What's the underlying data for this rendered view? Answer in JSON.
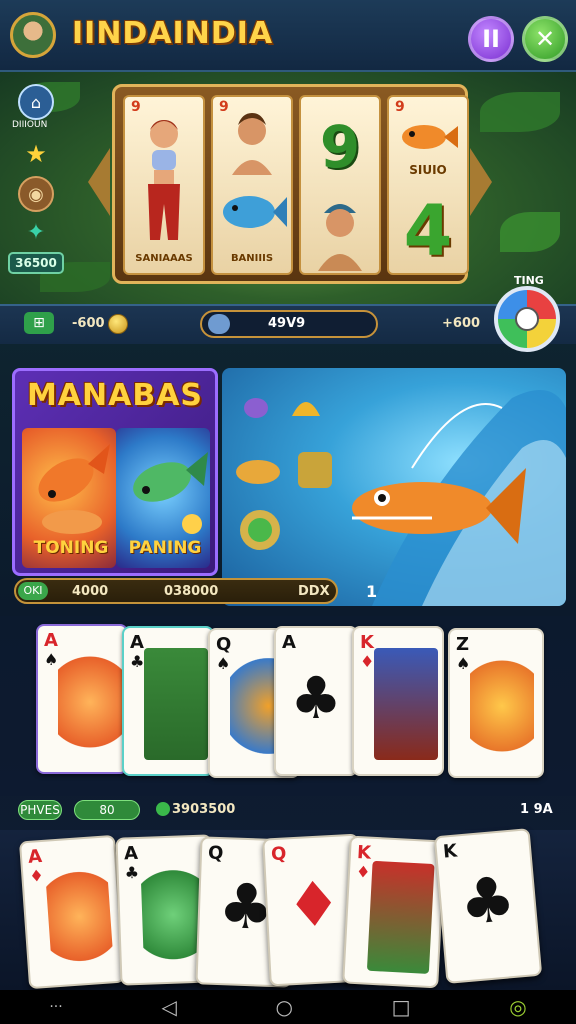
{
  "header": {
    "title": "IINDAINDIA",
    "pause_label": "II",
    "close_label": "✕"
  },
  "sidebar": {
    "label": "DIIIOUN",
    "money": "36500"
  },
  "slot": {
    "reels": [
      {
        "num": "9",
        "label": "SANIAAAS"
      },
      {
        "num": "9",
        "label": "BANIIIS"
      },
      {
        "top": "9"
      },
      {
        "num": "9",
        "mid": "SIUIO",
        "bottom": "4"
      }
    ]
  },
  "infobar": {
    "coins": "-600",
    "pill": "49V9",
    "right": "+600",
    "wheel_label": "TING"
  },
  "bonus": {
    "title": "MANABAS",
    "tiles": [
      "TONING",
      "PANING"
    ],
    "stats": {
      "badge": "OKI",
      "a": "4000",
      "b": "038000",
      "c": "DDX",
      "d": "1"
    }
  },
  "cards_row": [
    {
      "rank": "A",
      "suit": "♠",
      "color": "red"
    },
    {
      "rank": "A",
      "suit": "♣",
      "color": "black"
    },
    {
      "rank": "Q",
      "suit": "♠",
      "color": "black"
    },
    {
      "rank": "A",
      "suit": "♣",
      "color": "black"
    },
    {
      "rank": "K",
      "suit": "♦",
      "color": "red"
    },
    {
      "rank": "Z",
      "suit": "♠",
      "color": "black"
    }
  ],
  "bottom_stats": {
    "label": "PHVES",
    "value": "80",
    "score": "3903500",
    "right": "1 9A"
  },
  "hand": [
    {
      "rank": "A",
      "suit": "♦",
      "color": "red"
    },
    {
      "rank": "A",
      "suit": "♣",
      "color": "black"
    },
    {
      "rank": "Q",
      "suit": "♣",
      "color": "black"
    },
    {
      "rank": "Q",
      "suit": "♦",
      "color": "red"
    },
    {
      "rank": "K",
      "suit": "♦",
      "color": "red"
    },
    {
      "rank": "K",
      "suit": "♣",
      "color": "black"
    }
  ],
  "nav": {
    "back": "◁",
    "home": "○",
    "recent": "□"
  }
}
